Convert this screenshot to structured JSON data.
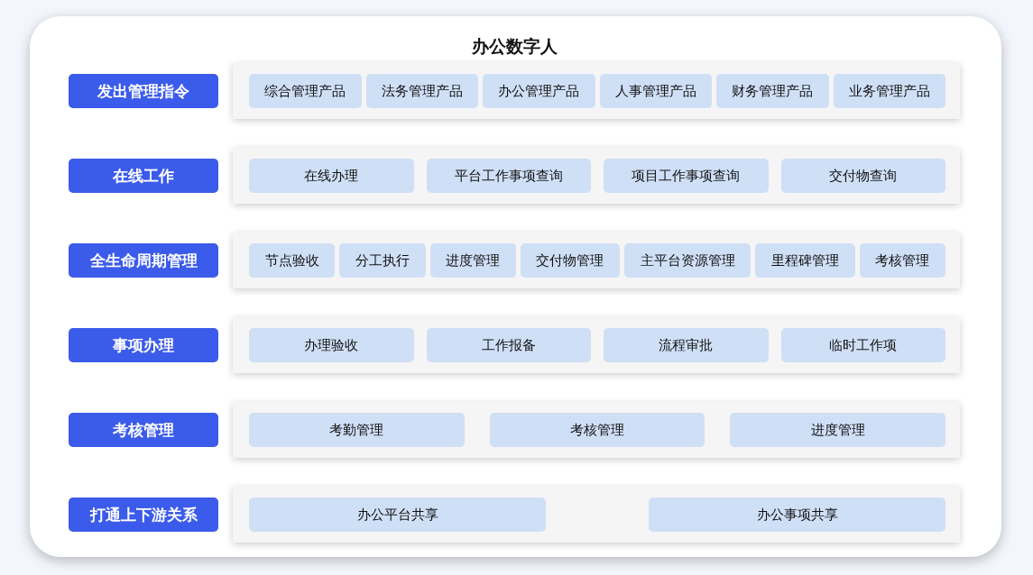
{
  "title": "办公数字人",
  "rows": [
    {
      "label": "发出管理指令",
      "kind": "fit",
      "items": [
        "综合管理产品",
        "法务管理产品",
        "办公管理产品",
        "人事管理产品",
        "财务管理产品",
        "业务管理产品"
      ]
    },
    {
      "label": "在线工作",
      "kind": "equal",
      "items": [
        "在线办理",
        "平台工作事项查询",
        "项目工作事项查询",
        "交付物查询"
      ]
    },
    {
      "label": "全生命周期管理",
      "kind": "fit",
      "items": [
        "节点验收",
        "分工执行",
        "进度管理",
        "交付物管理",
        "主平台资源管理",
        "里程碑管理",
        "考核管理"
      ]
    },
    {
      "label": "事项办理",
      "kind": "equal",
      "items": [
        "办理验收",
        "工作报备",
        "流程审批",
        "临时工作项"
      ]
    },
    {
      "label": "考核管理",
      "kind": "equal",
      "items": [
        "考勤管理",
        "考核管理",
        "进度管理"
      ]
    },
    {
      "label": "打通上下游关系",
      "kind": "spread",
      "items": [
        "办公平台共享",
        "办公事项共享"
      ]
    }
  ]
}
